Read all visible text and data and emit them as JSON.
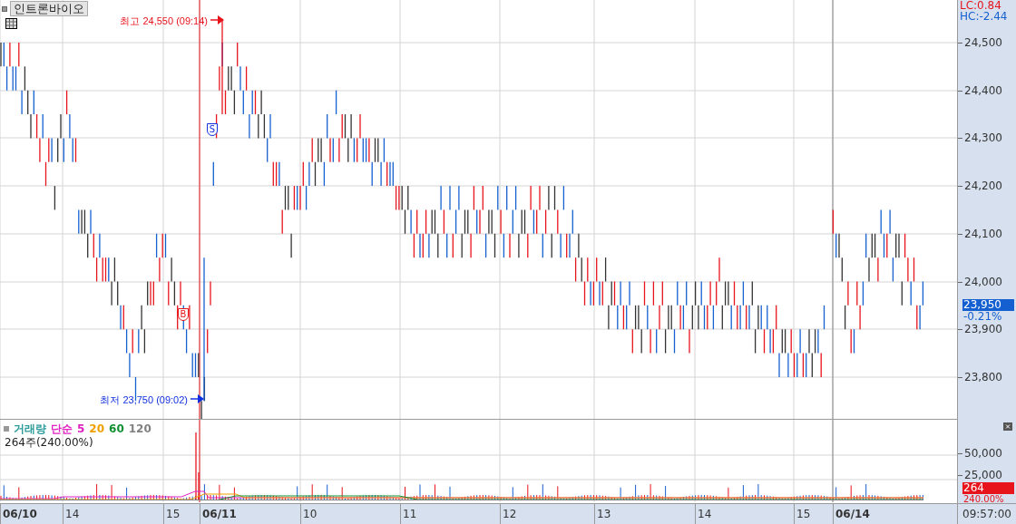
{
  "title": "인트론바이오",
  "price_pane": {
    "high_label": "최고 24,550 (09:14)",
    "low_label": "최저 23,750 (09:02)",
    "markers": [
      {
        "kind": "sell",
        "text": "S"
      },
      {
        "kind": "buy",
        "text": "B"
      }
    ]
  },
  "price_axis": {
    "lc": "LC:0.84",
    "hc": "HC:-2.44",
    "ticks": [
      "24,500",
      "24,400",
      "24,300",
      "24,200",
      "24,100",
      "24,000",
      "23,900",
      "23,800"
    ],
    "current": "23,950",
    "change": "-0.21%"
  },
  "volume_pane": {
    "legend": [
      {
        "text": "거래량",
        "color": "#2a9a9a"
      },
      {
        "text": "단순",
        "color": "#e020c0"
      },
      {
        "text": "5",
        "color": "#e020c0"
      },
      {
        "text": "20",
        "color": "#f0a000"
      },
      {
        "text": "60",
        "color": "#109030"
      },
      {
        "text": "120",
        "color": "#808080"
      }
    ],
    "summary": "264주(240.00%)"
  },
  "volume_axis": {
    "ticks": [
      "50,000",
      "25,000"
    ],
    "current": "264",
    "ratio": "240.00%"
  },
  "time_axis": {
    "labels": [
      {
        "text": "06/10",
        "kind": "date"
      },
      {
        "text": "14",
        "kind": "hour"
      },
      {
        "text": "15",
        "kind": "hour"
      },
      {
        "text": "06/11",
        "kind": "date"
      },
      {
        "text": "10",
        "kind": "hour"
      },
      {
        "text": "11",
        "kind": "hour"
      },
      {
        "text": "12",
        "kind": "hour"
      },
      {
        "text": "13",
        "kind": "hour"
      },
      {
        "text": "14",
        "kind": "hour"
      },
      {
        "text": "15",
        "kind": "hour"
      },
      {
        "text": "06/14",
        "kind": "date"
      }
    ],
    "time": "09:57:00"
  }
}
